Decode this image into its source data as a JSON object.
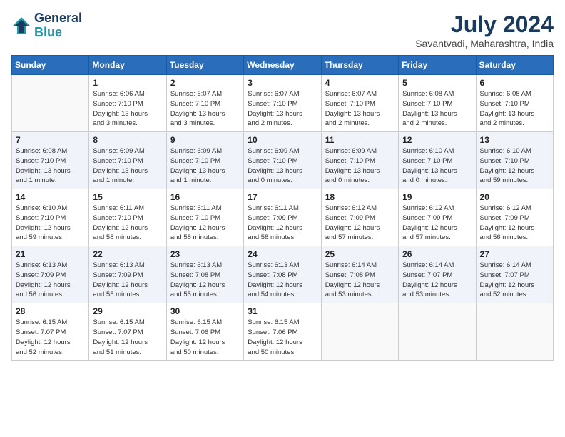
{
  "header": {
    "logo_line1": "General",
    "logo_line2": "Blue",
    "month_year": "July 2024",
    "location": "Savantvadi, Maharashtra, India"
  },
  "weekdays": [
    "Sunday",
    "Monday",
    "Tuesday",
    "Wednesday",
    "Thursday",
    "Friday",
    "Saturday"
  ],
  "weeks": [
    [
      {
        "day": "",
        "info": ""
      },
      {
        "day": "1",
        "info": "Sunrise: 6:06 AM\nSunset: 7:10 PM\nDaylight: 13 hours\nand 3 minutes."
      },
      {
        "day": "2",
        "info": "Sunrise: 6:07 AM\nSunset: 7:10 PM\nDaylight: 13 hours\nand 3 minutes."
      },
      {
        "day": "3",
        "info": "Sunrise: 6:07 AM\nSunset: 7:10 PM\nDaylight: 13 hours\nand 2 minutes."
      },
      {
        "day": "4",
        "info": "Sunrise: 6:07 AM\nSunset: 7:10 PM\nDaylight: 13 hours\nand 2 minutes."
      },
      {
        "day": "5",
        "info": "Sunrise: 6:08 AM\nSunset: 7:10 PM\nDaylight: 13 hours\nand 2 minutes."
      },
      {
        "day": "6",
        "info": "Sunrise: 6:08 AM\nSunset: 7:10 PM\nDaylight: 13 hours\nand 2 minutes."
      }
    ],
    [
      {
        "day": "7",
        "info": "Sunrise: 6:08 AM\nSunset: 7:10 PM\nDaylight: 13 hours\nand 1 minute."
      },
      {
        "day": "8",
        "info": "Sunrise: 6:09 AM\nSunset: 7:10 PM\nDaylight: 13 hours\nand 1 minute."
      },
      {
        "day": "9",
        "info": "Sunrise: 6:09 AM\nSunset: 7:10 PM\nDaylight: 13 hours\nand 1 minute."
      },
      {
        "day": "10",
        "info": "Sunrise: 6:09 AM\nSunset: 7:10 PM\nDaylight: 13 hours\nand 0 minutes."
      },
      {
        "day": "11",
        "info": "Sunrise: 6:09 AM\nSunset: 7:10 PM\nDaylight: 13 hours\nand 0 minutes."
      },
      {
        "day": "12",
        "info": "Sunrise: 6:10 AM\nSunset: 7:10 PM\nDaylight: 13 hours\nand 0 minutes."
      },
      {
        "day": "13",
        "info": "Sunrise: 6:10 AM\nSunset: 7:10 PM\nDaylight: 12 hours\nand 59 minutes."
      }
    ],
    [
      {
        "day": "14",
        "info": "Sunrise: 6:10 AM\nSunset: 7:10 PM\nDaylight: 12 hours\nand 59 minutes."
      },
      {
        "day": "15",
        "info": "Sunrise: 6:11 AM\nSunset: 7:10 PM\nDaylight: 12 hours\nand 58 minutes."
      },
      {
        "day": "16",
        "info": "Sunrise: 6:11 AM\nSunset: 7:10 PM\nDaylight: 12 hours\nand 58 minutes."
      },
      {
        "day": "17",
        "info": "Sunrise: 6:11 AM\nSunset: 7:09 PM\nDaylight: 12 hours\nand 58 minutes."
      },
      {
        "day": "18",
        "info": "Sunrise: 6:12 AM\nSunset: 7:09 PM\nDaylight: 12 hours\nand 57 minutes."
      },
      {
        "day": "19",
        "info": "Sunrise: 6:12 AM\nSunset: 7:09 PM\nDaylight: 12 hours\nand 57 minutes."
      },
      {
        "day": "20",
        "info": "Sunrise: 6:12 AM\nSunset: 7:09 PM\nDaylight: 12 hours\nand 56 minutes."
      }
    ],
    [
      {
        "day": "21",
        "info": "Sunrise: 6:13 AM\nSunset: 7:09 PM\nDaylight: 12 hours\nand 56 minutes."
      },
      {
        "day": "22",
        "info": "Sunrise: 6:13 AM\nSunset: 7:09 PM\nDaylight: 12 hours\nand 55 minutes."
      },
      {
        "day": "23",
        "info": "Sunrise: 6:13 AM\nSunset: 7:08 PM\nDaylight: 12 hours\nand 55 minutes."
      },
      {
        "day": "24",
        "info": "Sunrise: 6:13 AM\nSunset: 7:08 PM\nDaylight: 12 hours\nand 54 minutes."
      },
      {
        "day": "25",
        "info": "Sunrise: 6:14 AM\nSunset: 7:08 PM\nDaylight: 12 hours\nand 53 minutes."
      },
      {
        "day": "26",
        "info": "Sunrise: 6:14 AM\nSunset: 7:07 PM\nDaylight: 12 hours\nand 53 minutes."
      },
      {
        "day": "27",
        "info": "Sunrise: 6:14 AM\nSunset: 7:07 PM\nDaylight: 12 hours\nand 52 minutes."
      }
    ],
    [
      {
        "day": "28",
        "info": "Sunrise: 6:15 AM\nSunset: 7:07 PM\nDaylight: 12 hours\nand 52 minutes."
      },
      {
        "day": "29",
        "info": "Sunrise: 6:15 AM\nSunset: 7:07 PM\nDaylight: 12 hours\nand 51 minutes."
      },
      {
        "day": "30",
        "info": "Sunrise: 6:15 AM\nSunset: 7:06 PM\nDaylight: 12 hours\nand 50 minutes."
      },
      {
        "day": "31",
        "info": "Sunrise: 6:15 AM\nSunset: 7:06 PM\nDaylight: 12 hours\nand 50 minutes."
      },
      {
        "day": "",
        "info": ""
      },
      {
        "day": "",
        "info": ""
      },
      {
        "day": "",
        "info": ""
      }
    ]
  ]
}
